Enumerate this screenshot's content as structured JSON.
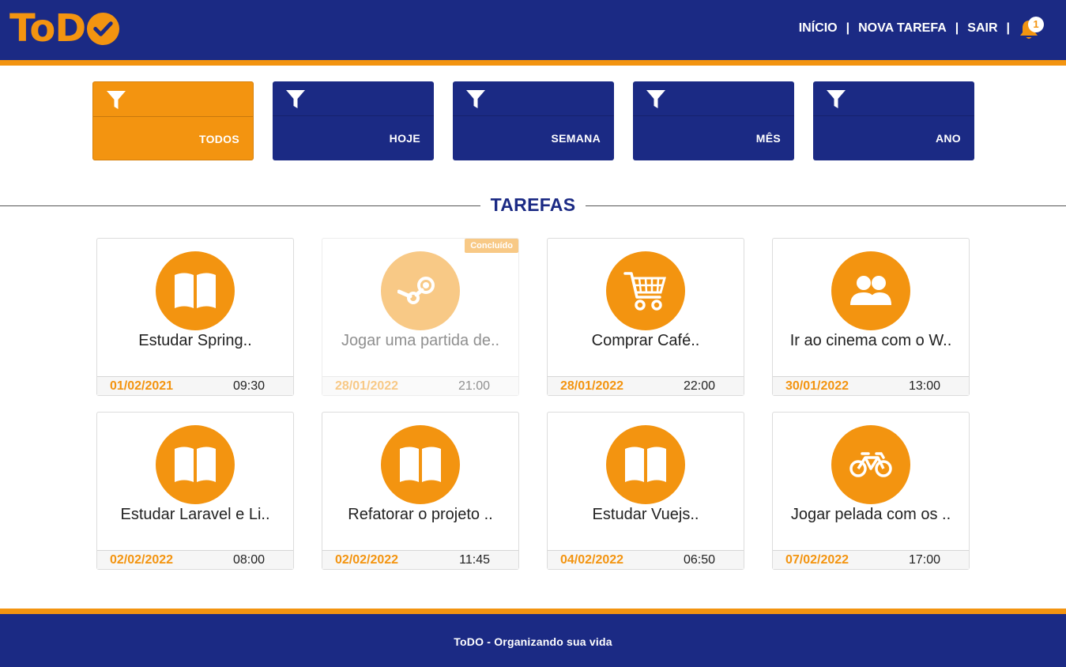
{
  "brand": {
    "logo_text": "ToD",
    "color_primary": "#1b2a84",
    "color_accent": "#f39410"
  },
  "nav": {
    "items": [
      {
        "label": "INÍCIO"
      },
      {
        "label": "NOVA TAREFA"
      },
      {
        "label": "SAIR"
      }
    ],
    "separator": "|",
    "notification_count": "1"
  },
  "filters": [
    {
      "label": "TODOS",
      "active": true,
      "icon": "filter-icon"
    },
    {
      "label": "HOJE",
      "active": false,
      "icon": "filter-icon"
    },
    {
      "label": "SEMANA",
      "active": false,
      "icon": "filter-icon"
    },
    {
      "label": "MÊS",
      "active": false,
      "icon": "filter-icon"
    },
    {
      "label": "ANO",
      "active": false,
      "icon": "filter-icon"
    }
  ],
  "section": {
    "title": "TAREFAS"
  },
  "tasks": [
    {
      "title": "Estudar Spring..",
      "date": "01/02/2021",
      "time": "09:30",
      "icon": "book-icon",
      "done": false
    },
    {
      "title": "Jogar uma partida de..",
      "date": "28/01/2022",
      "time": "21:00",
      "icon": "steam-icon",
      "done": true,
      "badge": "Concluído"
    },
    {
      "title": "Comprar Café..",
      "date": "28/01/2022",
      "time": "22:00",
      "icon": "cart-icon",
      "done": false
    },
    {
      "title": "Ir ao cinema com o W..",
      "date": "30/01/2022",
      "time": "13:00",
      "icon": "users-icon",
      "done": false
    },
    {
      "title": "Estudar Laravel e Li..",
      "date": "02/02/2022",
      "time": "08:00",
      "icon": "book-icon",
      "done": false
    },
    {
      "title": "Refatorar o projeto ..",
      "date": "02/02/2022",
      "time": "11:45",
      "icon": "book-icon",
      "done": false
    },
    {
      "title": "Estudar Vuejs..",
      "date": "04/02/2022",
      "time": "06:50",
      "icon": "book-icon",
      "done": false
    },
    {
      "title": "Jogar pelada com os ..",
      "date": "07/02/2022",
      "time": "17:00",
      "icon": "bicycle-icon",
      "done": false
    }
  ],
  "footer": {
    "text": "ToDO - Organizando sua vida"
  }
}
